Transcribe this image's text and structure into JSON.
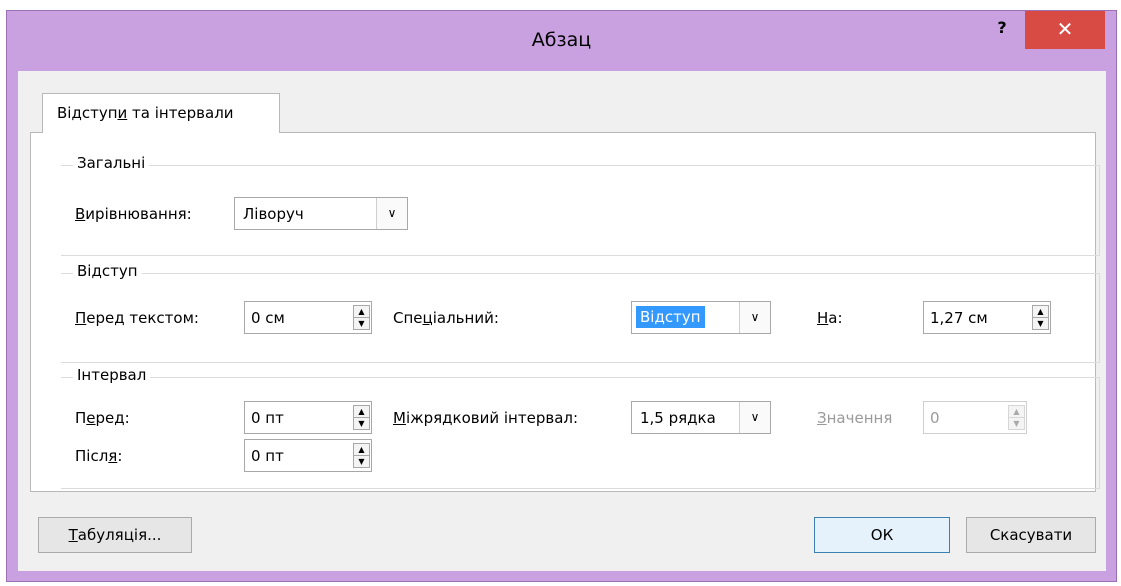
{
  "window": {
    "title": "Абзац",
    "help_label": "?",
    "close_label": "✕",
    "accent_color": "#c9a0e0",
    "close_color": "#d84b45"
  },
  "tabs": [
    {
      "label_pre": "Відступ",
      "label_u": "и",
      "label_post": " та інтервали"
    }
  ],
  "general": {
    "title": "Загальні",
    "alignment_label_u": "В",
    "alignment_label_rest": "ирівнювання:",
    "alignment_value": "Ліворуч"
  },
  "indent": {
    "title": "Відступ",
    "before_label_u": "П",
    "before_label_rest": "еред текстом:",
    "before_value": "0 см",
    "special_label_pre": "Спе",
    "special_label_u": "ц",
    "special_label_post": "іальний:",
    "special_value": "Відступ",
    "by_label_u": "Н",
    "by_label_rest": "а:",
    "by_value": "1,27 см"
  },
  "spacing": {
    "title": "Інтервал",
    "before_label_pre": "П",
    "before_label_u": "е",
    "before_label_post": "ред:",
    "before_value": "0 пт",
    "after_label_pre": "Післ",
    "after_label_u": "я",
    "after_label_post": ":",
    "after_value": "0 пт",
    "line_label_u": "М",
    "line_label_rest": "іжрядковий інтервал:",
    "line_value": "1,5 рядка",
    "at_label_u": "З",
    "at_label_rest": "начення",
    "at_value": "0"
  },
  "footer": {
    "tabs_button_u": "Т",
    "tabs_button_rest": "абуляція...",
    "ok_label": "ОК",
    "cancel_label": "Скасувати"
  }
}
